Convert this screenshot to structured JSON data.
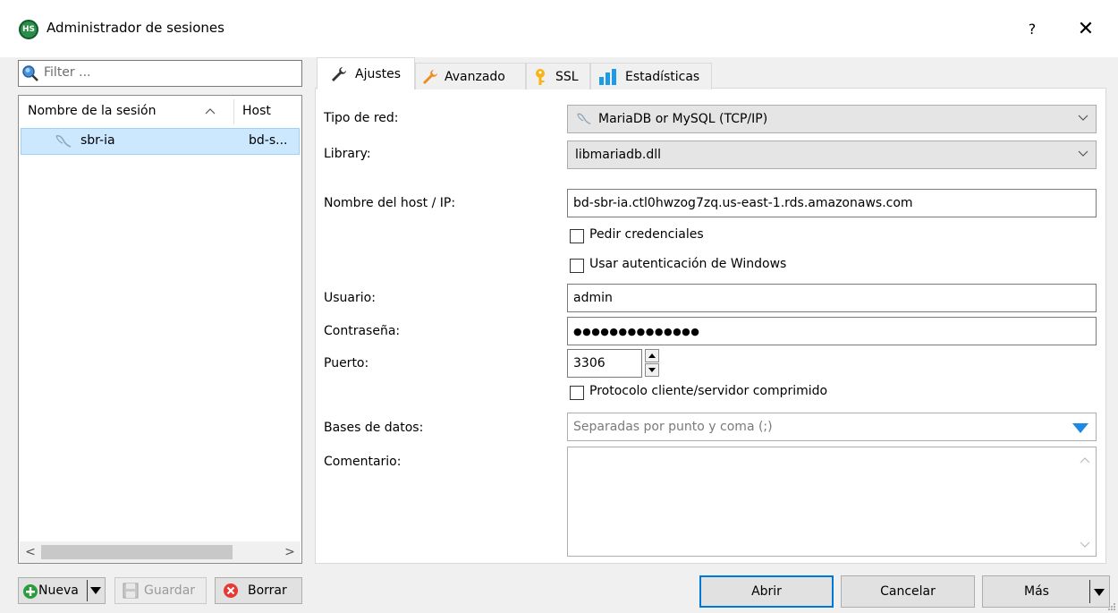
{
  "window": {
    "title": "Administrador de sesiones",
    "app_icon_text": "HS",
    "help_label": "?",
    "close_label": "✕"
  },
  "left": {
    "filter_placeholder": "Filter ...",
    "columns": {
      "name": "Nombre de la sesión",
      "host": "Host",
      "sort_glyph": "^"
    },
    "sessions": [
      {
        "name": "sbr-ia",
        "host": "bd-s...",
        "selected": true
      }
    ],
    "buttons": {
      "nueva": "Nueva",
      "guardar": "Guardar",
      "borrar": "Borrar"
    }
  },
  "tabs": [
    {
      "label": "Ajustes",
      "icon": "wrench-icon",
      "active": true
    },
    {
      "label": "Avanzado",
      "icon": "wrench-orange-icon",
      "active": false
    },
    {
      "label": "SSL",
      "icon": "key-icon",
      "active": false
    },
    {
      "label": "Estadísticas",
      "icon": "bar-chart-icon",
      "active": false
    }
  ],
  "settings": {
    "network_type": {
      "label": "Tipo de red:",
      "value": "MariaDB or MySQL (TCP/IP)"
    },
    "library": {
      "label": "Library:",
      "value": "libmariadb.dll"
    },
    "hostname": {
      "label": "Nombre del host / IP:",
      "value": "bd-sbr-ia.ctl0hwzog7zq.us-east-1.rds.amazonaws.com"
    },
    "ask_credentials": {
      "label": "Pedir credenciales",
      "checked": false
    },
    "windows_auth": {
      "label": "Usar autenticación de Windows",
      "checked": false
    },
    "user": {
      "label": "Usuario:",
      "value": "admin"
    },
    "password": {
      "label": "Contraseña:",
      "value": "●●●●●●●●●●●●●●"
    },
    "port": {
      "label": "Puerto:",
      "value": "3306"
    },
    "compressed": {
      "label": "Protocolo cliente/servidor comprimido",
      "checked": false
    },
    "databases": {
      "label": "Bases de datos:",
      "placeholder": "Separadas por punto y coma (;)"
    },
    "comment": {
      "label": "Comentario:",
      "value": ""
    }
  },
  "footer": {
    "open": "Abrir",
    "cancel": "Cancelar",
    "more": "Más"
  },
  "colors": {
    "selection": "#cce8ff",
    "accent_blue": "#1e88e5",
    "green": "#2a9d3a",
    "red": "#e53935"
  }
}
